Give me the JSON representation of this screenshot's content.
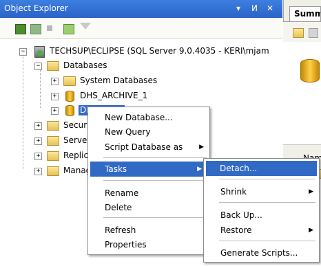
{
  "window": {
    "title": "Object Explorer",
    "buttons": {
      "dropdown": "▾",
      "pin": "ⵍ",
      "close": "✕"
    },
    "right_tab": "Summary"
  },
  "tree": {
    "server": "TECHSUP\\ECLIPSE (SQL Server 9.0.4035 - KERI\\mjam",
    "databases": "Databases",
    "system_databases": "System Databases",
    "db1": "DHS_ARCHIVE_1",
    "db2": "DHS_MAIN",
    "security": "Security",
    "server_objects": "Server Objects",
    "replication": "Replication",
    "management": "Management"
  },
  "context_menu": {
    "items": [
      "New Database...",
      "New Query",
      "Script Database as",
      "Tasks",
      "Rename",
      "Delete",
      "Refresh",
      "Properties"
    ]
  },
  "tasks_menu": {
    "items": [
      "Detach...",
      "Shrink",
      "Back Up...",
      "Restore",
      "Generate Scripts..."
    ]
  },
  "right_pane": {
    "labels": [
      "Nam"
    ]
  },
  "colors": {
    "titlebar": "#2a63c9",
    "selection": "#316ac5",
    "folder": "#e7c257"
  }
}
